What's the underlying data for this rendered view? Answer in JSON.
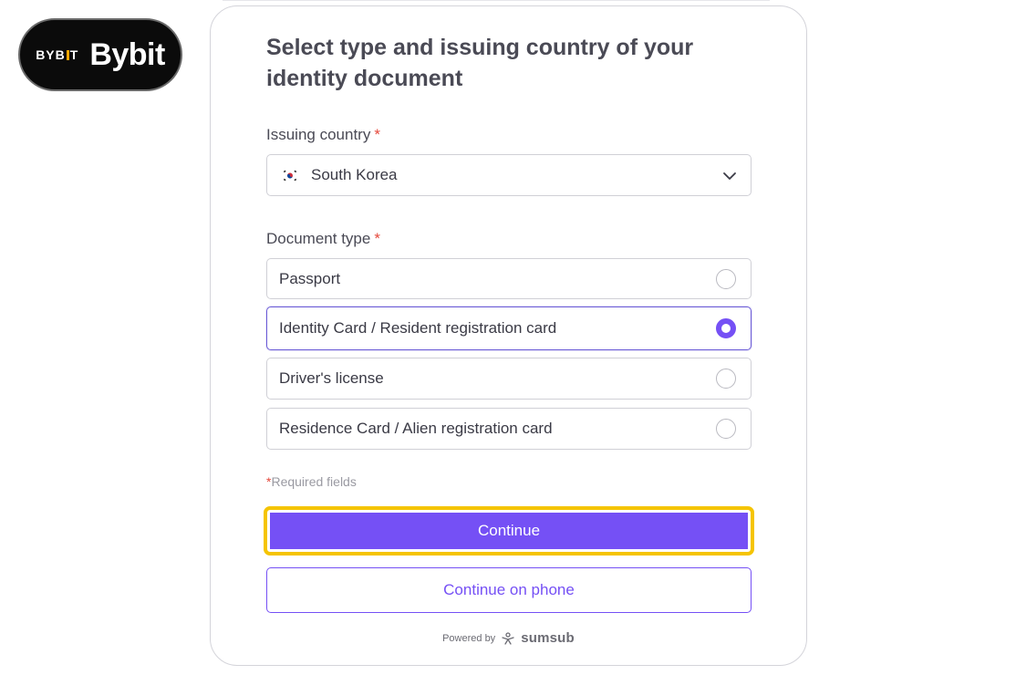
{
  "brand": {
    "logo_text": "BYBIT",
    "name": "Bybit"
  },
  "form": {
    "title": "Select type and issuing country of your identity document",
    "country": {
      "label": "Issuing country",
      "required_mark": "*",
      "value": "South Korea",
      "flag_icon": "south-korea-flag-icon"
    },
    "document_type": {
      "label": "Document type",
      "required_mark": "*",
      "options": [
        {
          "label": "Passport",
          "selected": false
        },
        {
          "label": "Identity Card / Resident registration card",
          "selected": true
        },
        {
          "label": "Driver's license",
          "selected": false
        },
        {
          "label": "Residence Card / Alien registration card",
          "selected": false
        }
      ]
    },
    "required_note": {
      "mark": "*",
      "text": "Required fields"
    },
    "continue_label": "Continue",
    "continue_phone_label": "Continue on phone"
  },
  "footer": {
    "powered_by": "Powered by",
    "provider": "sumsub"
  },
  "colors": {
    "accent": "#7550f5",
    "highlight": "#f5c400",
    "required": "#e5483b",
    "brand_badge_bg": "#0b0b0b"
  }
}
